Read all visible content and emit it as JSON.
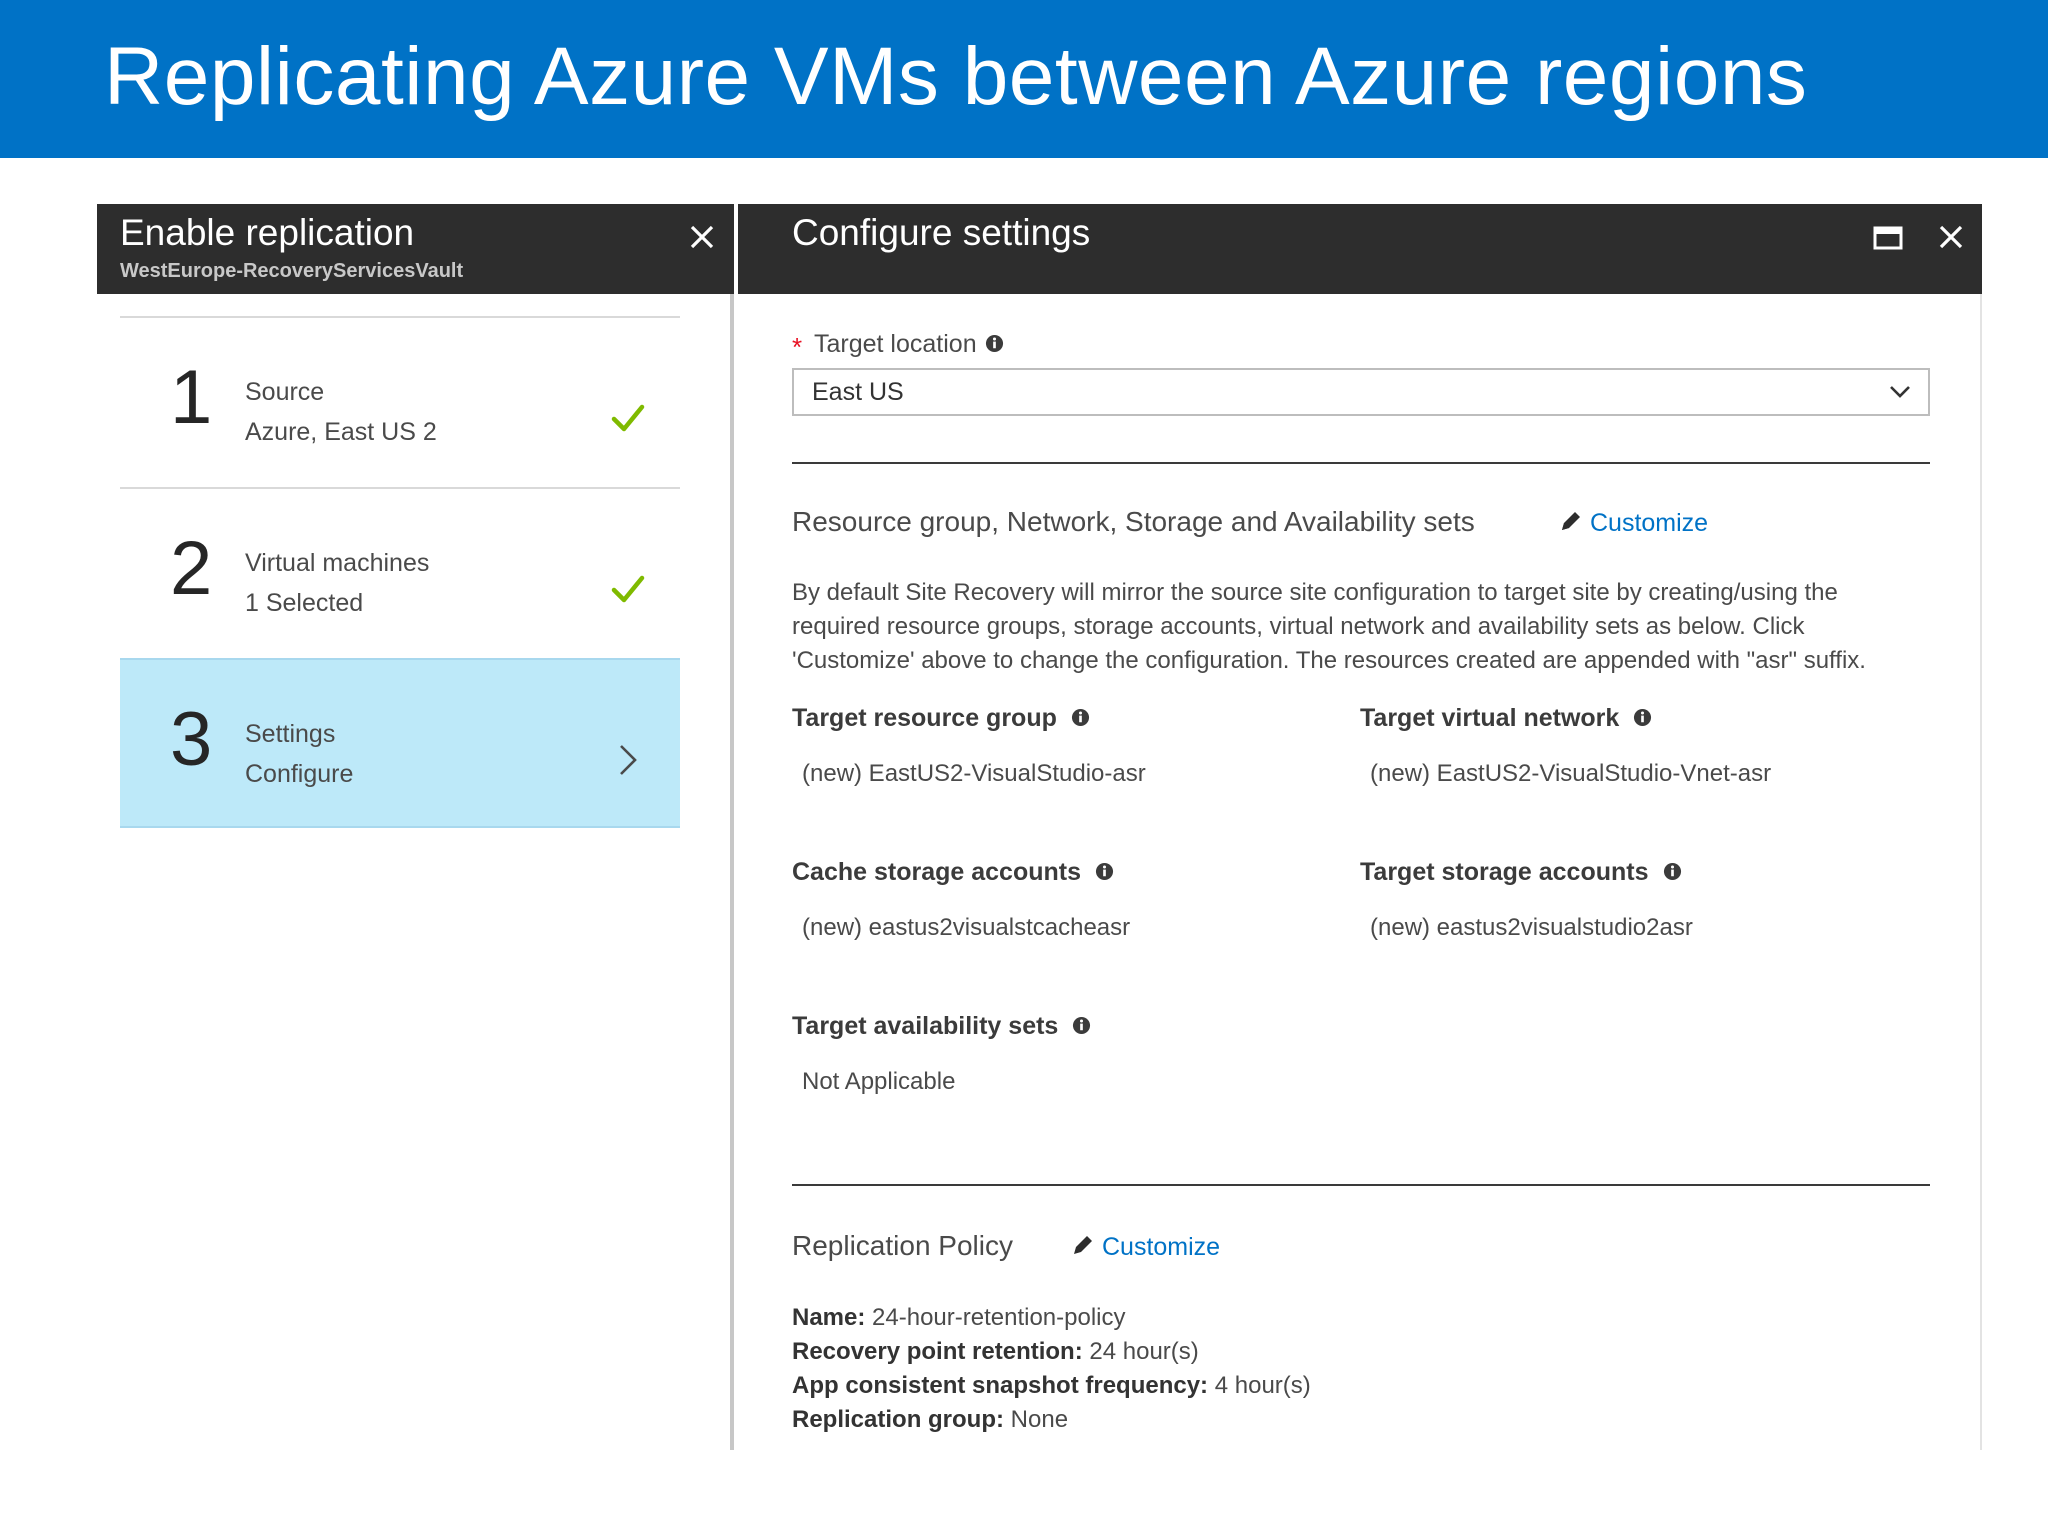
{
  "page": {
    "title": "Replicating Azure VMs between Azure regions"
  },
  "left_blade": {
    "title": "Enable replication",
    "subtitle": "WestEurope-RecoveryServicesVault",
    "steps": [
      {
        "number": "1",
        "title": "Source",
        "subtitle": "Azure, East US 2",
        "status": "complete"
      },
      {
        "number": "2",
        "title": "Virtual machines",
        "subtitle": "1 Selected",
        "status": "complete"
      },
      {
        "number": "3",
        "title": "Settings",
        "subtitle": "Configure",
        "status": "active"
      }
    ]
  },
  "right_blade": {
    "title": "Configure settings",
    "target_location": {
      "required_marker": "*",
      "label": "Target location",
      "value": "East US"
    },
    "resource_section": {
      "title": "Resource group, Network, Storage and Availability sets",
      "customize_label": "Customize",
      "description": "By default Site Recovery will mirror the source site configuration to target site by creating/using the required resource groups, storage accounts, virtual network and availability sets as below. Click 'Customize' above to change the configuration. The resources created are appended with \"asr\" suffix.",
      "fields": {
        "target_resource_group": {
          "label": "Target resource group",
          "value": "(new) EastUS2-VisualStudio-asr"
        },
        "target_virtual_network": {
          "label": "Target virtual network",
          "value": "(new) EastUS2-VisualStudio-Vnet-asr"
        },
        "cache_storage_accounts": {
          "label": "Cache storage accounts",
          "value": "(new) eastus2visualstcacheasr"
        },
        "target_storage_accounts": {
          "label": "Target storage accounts",
          "value": "(new) eastus2visualstudio2asr"
        },
        "target_availability_sets": {
          "label": "Target availability sets",
          "value": "Not Applicable"
        }
      }
    },
    "replication_policy": {
      "title": "Replication Policy",
      "customize_label": "Customize",
      "name_label": "Name:",
      "name_value": "24-hour-retention-policy",
      "retention_label": "Recovery point retention:",
      "retention_value": "24 hour(s)",
      "snapshot_label": "App consistent snapshot frequency:",
      "snapshot_value": "4 hour(s)",
      "group_label": "Replication group:",
      "group_value": "None"
    }
  },
  "colors": {
    "banner": "#0072c6",
    "blade_header": "#2d2d2d",
    "active_step": "#bde9f9",
    "check": "#7fba00",
    "link": "#0072c6",
    "required": "#e81123"
  }
}
